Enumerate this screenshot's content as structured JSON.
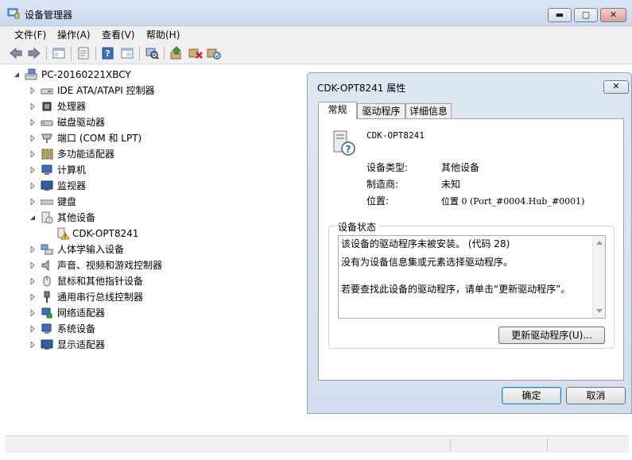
{
  "window": {
    "title": "设备管理器",
    "min_label": "▬",
    "max_label": "▢",
    "close_label": "✕"
  },
  "menu": [
    {
      "label": "文件(F)"
    },
    {
      "label": "操作(A)"
    },
    {
      "label": "查看(V)"
    },
    {
      "label": "帮助(H)"
    }
  ],
  "tree": {
    "root": "PC-20160221XBCY",
    "items": [
      {
        "label": "IDE ATA/ATAPI 控制器",
        "icon": "ide-controller-icon"
      },
      {
        "label": "处理器",
        "icon": "processor-icon"
      },
      {
        "label": "磁盘驱动器",
        "icon": "disk-drive-icon"
      },
      {
        "label": "端口 (COM 和 LPT)",
        "icon": "port-icon"
      },
      {
        "label": "多功能适配器",
        "icon": "multifunction-adapter-icon"
      },
      {
        "label": "计算机",
        "icon": "computer-icon"
      },
      {
        "label": "监视器",
        "icon": "monitor-icon"
      },
      {
        "label": "键盘",
        "icon": "keyboard-icon"
      },
      {
        "label": "其他设备",
        "icon": "other-devices-icon"
      },
      {
        "label": "CDK-OPT8241",
        "icon": "unknown-device-warning-icon"
      },
      {
        "label": "人体学输入设备",
        "icon": "hid-icon"
      },
      {
        "label": "声音、视频和游戏控制器",
        "icon": "sound-icon"
      },
      {
        "label": "鼠标和其他指针设备",
        "icon": "mouse-icon"
      },
      {
        "label": "通用串行总线控制器",
        "icon": "usb-icon"
      },
      {
        "label": "网络适配器",
        "icon": "network-adapter-icon"
      },
      {
        "label": "系统设备",
        "icon": "system-devices-icon"
      },
      {
        "label": "显示适配器",
        "icon": "display-adapter-icon"
      }
    ]
  },
  "dialog": {
    "title": "CDK-OPT8241 属性",
    "close_label": "✕",
    "tabs": [
      {
        "label": "常规"
      },
      {
        "label": "驱动程序"
      },
      {
        "label": "详细信息"
      }
    ],
    "device_name": "CDK-OPT8241",
    "props": [
      {
        "label": "设备类型:",
        "value": "其他设备"
      },
      {
        "label": "制造商:",
        "value": "未知"
      },
      {
        "label": "位置:",
        "value": "位置 0 (Port_#0004.Hub_#0001)"
      }
    ],
    "status_group": "设备状态",
    "status_lines": [
      "该设备的驱动程序未被安装。 (代码 28)",
      "没有为设备信息集或元素选择驱动程序。",
      "若要查找此设备的驱动程序，请单击“更新驱动程序”。"
    ],
    "update_button": "更新驱动程序(U)...",
    "ok_button": "确定",
    "cancel_button": "取消"
  }
}
